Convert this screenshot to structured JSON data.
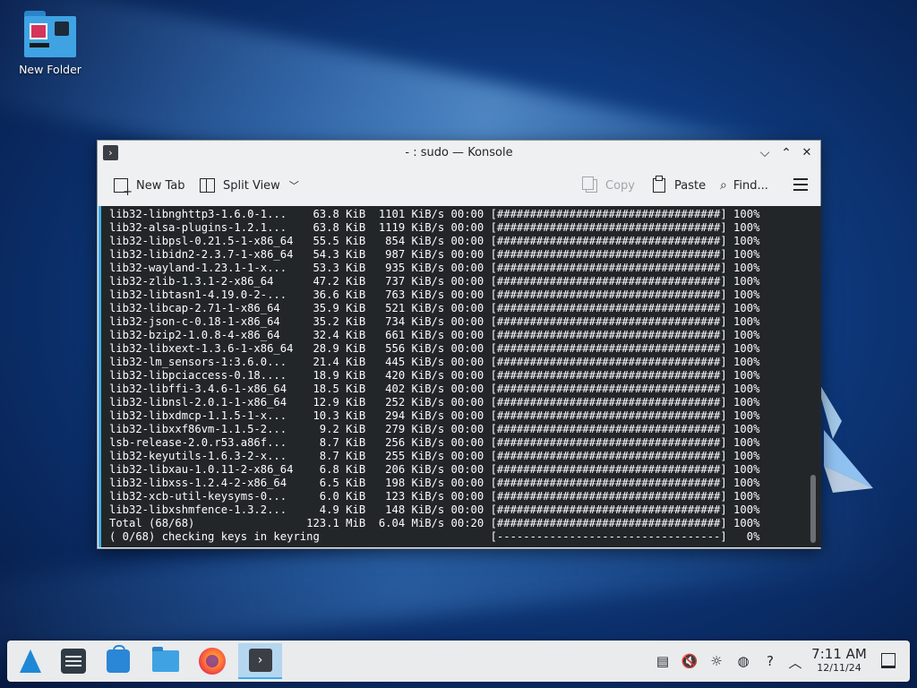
{
  "desktop": {
    "icons": [
      {
        "label": "New Folder"
      }
    ]
  },
  "window": {
    "title": "- : sudo — Konsole",
    "controls": {
      "minimize": "⌵",
      "maximize": "⌃",
      "close": "✕"
    },
    "toolbar": {
      "new_tab": "New Tab",
      "split_view": "Split View",
      "copy": "Copy",
      "paste": "Paste",
      "find": "Find..."
    }
  },
  "terminal": {
    "lines": [
      "lib32-libnghttp3-1.6.0-1...    63.8 KiB  1101 KiB/s 00:00 [##################################] 100%",
      "lib32-alsa-plugins-1.2.1...    63.8 KiB  1119 KiB/s 00:00 [##################################] 100%",
      "lib32-libpsl-0.21.5-1-x86_64   55.5 KiB   854 KiB/s 00:00 [##################################] 100%",
      "lib32-libidn2-2.3.7-1-x86_64   54.3 KiB   987 KiB/s 00:00 [##################################] 100%",
      "lib32-wayland-1.23.1-1-x...    53.3 KiB   935 KiB/s 00:00 [##################################] 100%",
      "lib32-zlib-1.3.1-2-x86_64      47.2 KiB   737 KiB/s 00:00 [##################################] 100%",
      "lib32-libtasn1-4.19.0-2-...    36.6 KiB   763 KiB/s 00:00 [##################################] 100%",
      "lib32-libcap-2.71-1-x86_64     35.9 KiB   521 KiB/s 00:00 [##################################] 100%",
      "lib32-json-c-0.18-1-x86_64     35.2 KiB   734 KiB/s 00:00 [##################################] 100%",
      "lib32-bzip2-1.0.8-4-x86_64     32.4 KiB   661 KiB/s 00:00 [##################################] 100%",
      "lib32-libxext-1.3.6-1-x86_64   28.9 KiB   556 KiB/s 00:00 [##################################] 100%",
      "lib32-lm_sensors-1:3.6.0...    21.4 KiB   445 KiB/s 00:00 [##################################] 100%",
      "lib32-libpciaccess-0.18....    18.9 KiB   420 KiB/s 00:00 [##################################] 100%",
      "lib32-libffi-3.4.6-1-x86_64    18.5 KiB   402 KiB/s 00:00 [##################################] 100%",
      "lib32-libnsl-2.0.1-1-x86_64    12.9 KiB   252 KiB/s 00:00 [##################################] 100%",
      "lib32-libxdmcp-1.1.5-1-x...    10.3 KiB   294 KiB/s 00:00 [##################################] 100%",
      "lib32-libxxf86vm-1.1.5-2...     9.2 KiB   279 KiB/s 00:00 [##################################] 100%",
      "lsb-release-2.0.r53.a86f...     8.7 KiB   256 KiB/s 00:00 [##################################] 100%",
      "lib32-keyutils-1.6.3-2-x...     8.7 KiB   255 KiB/s 00:00 [##################################] 100%",
      "lib32-libxau-1.0.11-2-x86_64    6.8 KiB   206 KiB/s 00:00 [##################################] 100%",
      "lib32-libxss-1.2.4-2-x86_64     6.5 KiB   198 KiB/s 00:00 [##################################] 100%",
      "lib32-xcb-util-keysyms-0...     6.0 KiB   123 KiB/s 00:00 [##################################] 100%",
      "lib32-libxshmfence-1.3.2...     4.9 KiB   148 KiB/s 00:00 [##################################] 100%",
      "Total (68/68)                 123.1 MiB  6.04 MiB/s 00:20 [##################################] 100%",
      "( 0/68) checking keys in keyring                          [----------------------------------]   0%"
    ]
  },
  "taskbar": {
    "clock_time": "7:11 AM",
    "clock_date": "12/11/24"
  },
  "colors": {
    "accent": "#3daee9",
    "terminal_bg": "#232629",
    "terminal_fg": "#fcfcfc"
  }
}
